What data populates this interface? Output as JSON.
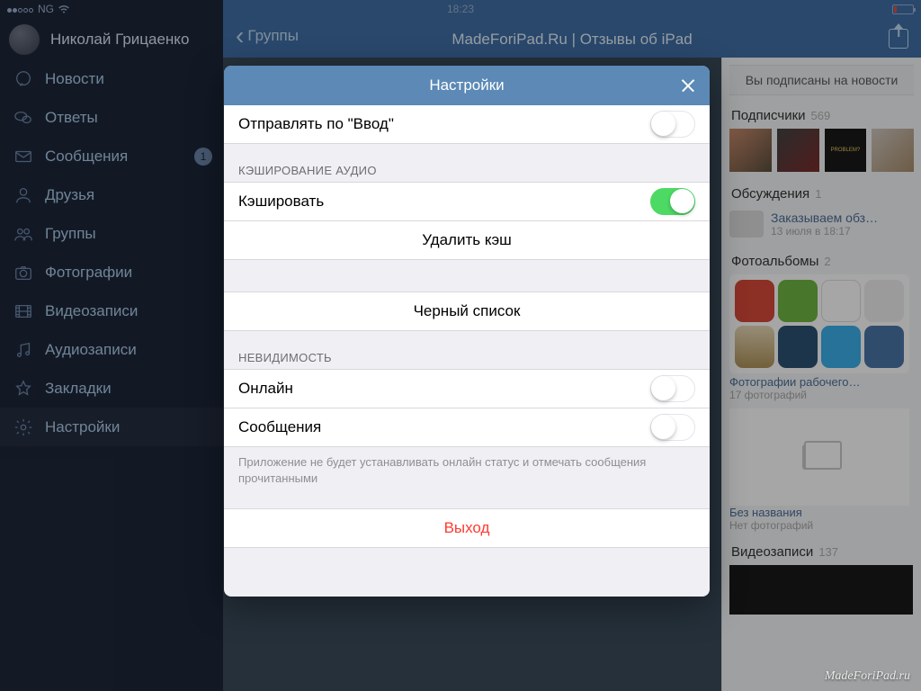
{
  "statusbar": {
    "carrier": "NG",
    "time": "18:23"
  },
  "sidebar": {
    "username": "Николай Грицаенко",
    "items": [
      {
        "label": "Новости"
      },
      {
        "label": "Ответы"
      },
      {
        "label": "Сообщения",
        "badge": "1"
      },
      {
        "label": "Друзья"
      },
      {
        "label": "Группы"
      },
      {
        "label": "Фотографии"
      },
      {
        "label": "Видеозаписи"
      },
      {
        "label": "Аудиозаписи"
      },
      {
        "label": "Закладки"
      },
      {
        "label": "Настройки"
      }
    ]
  },
  "navbar": {
    "back": "Группы",
    "title": "MadeForiPad.Ru | Отзывы об iPad"
  },
  "right": {
    "subscribed": "Вы подписаны на новости",
    "subscribers_label": "Подписчики",
    "subscribers_count": "569",
    "discussions_label": "Обсуждения",
    "discussions_count": "1",
    "discussion_title": "Заказываем обз…",
    "discussion_date": "13 июля в 18:17",
    "photoalbums_label": "Фотоальбомы",
    "photoalbums_count": "2",
    "album1_title": "Фотографии рабочего…",
    "album1_count": "17 фотографий",
    "album2_title": "Без названия",
    "album2_count": "Нет фотографий",
    "videos_label": "Видеозаписи",
    "videos_count": "137",
    "thumb3_text": "PROBLEM?"
  },
  "modal": {
    "title": "Настройки",
    "send_on_enter": "Отправлять по \"Ввод\"",
    "section_cache": "КЭШИРОВАНИЕ АУДИО",
    "cache_toggle": "Кэшировать",
    "clear_cache": "Удалить кэш",
    "blacklist": "Черный список",
    "section_invis": "НЕВИДИМОСТЬ",
    "online": "Онлайн",
    "messages": "Сообщения",
    "footnote": "Приложение не будет устанавливать онлайн статус и отмечать сообщения прочитанными",
    "logout": "Выход"
  },
  "watermark": "MadeForiPad.ru"
}
